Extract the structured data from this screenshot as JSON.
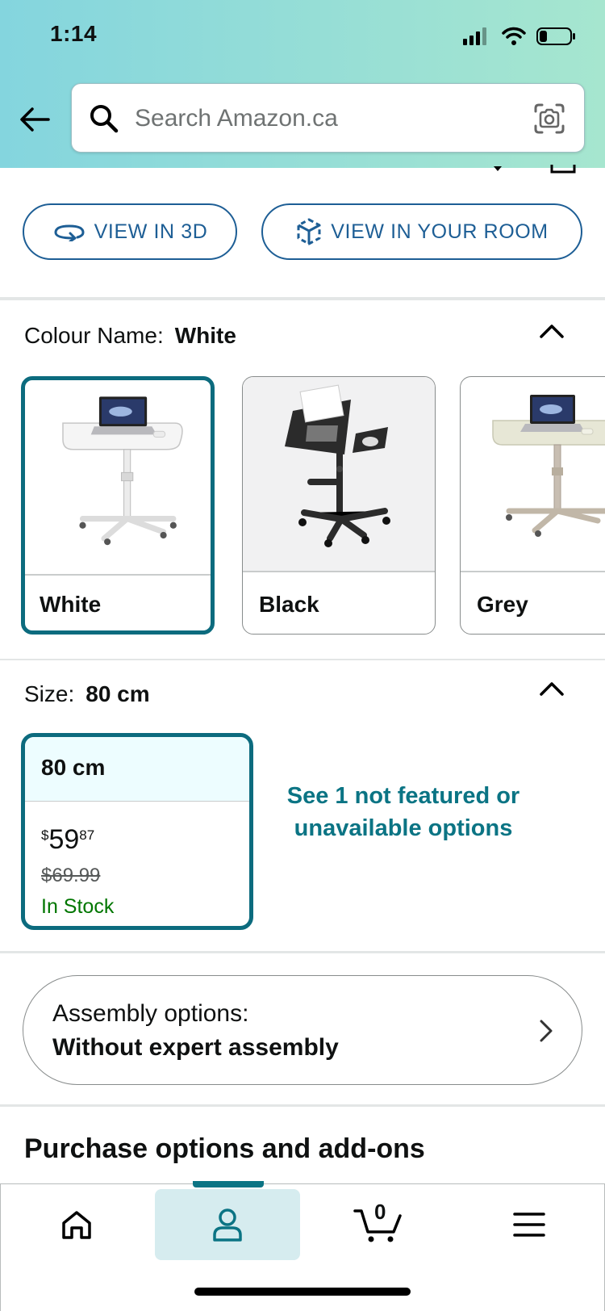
{
  "status_bar": {
    "time": "1:14"
  },
  "search": {
    "placeholder": "Search Amazon.ca"
  },
  "view_buttons": {
    "view_3d": "VIEW IN 3D",
    "view_room": "VIEW IN YOUR ROOM"
  },
  "colour": {
    "label": "Colour Name:",
    "selected": "White",
    "options": [
      {
        "label": "White",
        "selected": true
      },
      {
        "label": "Black",
        "selected": false
      },
      {
        "label": "Grey",
        "selected": false
      }
    ]
  },
  "size": {
    "label": "Size:",
    "selected": "80 cm",
    "option": {
      "label": "80 cm",
      "price_symbol": "$",
      "price_whole": "59",
      "price_fraction": "87",
      "list_price": "$69.99",
      "availability": "In Stock"
    },
    "not_featured_link": "See 1 not featured or unavailable options"
  },
  "assembly": {
    "label": "Assembly options:",
    "value": "Without expert assembly"
  },
  "purchase_options_title": "Purchase options and add-ons",
  "bottom_nav": {
    "items": [
      "home-icon",
      "account-icon",
      "cart-icon",
      "menu-icon"
    ],
    "active": "account-icon",
    "cart_count": "0"
  },
  "colors": {
    "teal_accent": "#0c6b7e",
    "link_blue": "#1d5e95",
    "in_stock_green": "#007600"
  }
}
